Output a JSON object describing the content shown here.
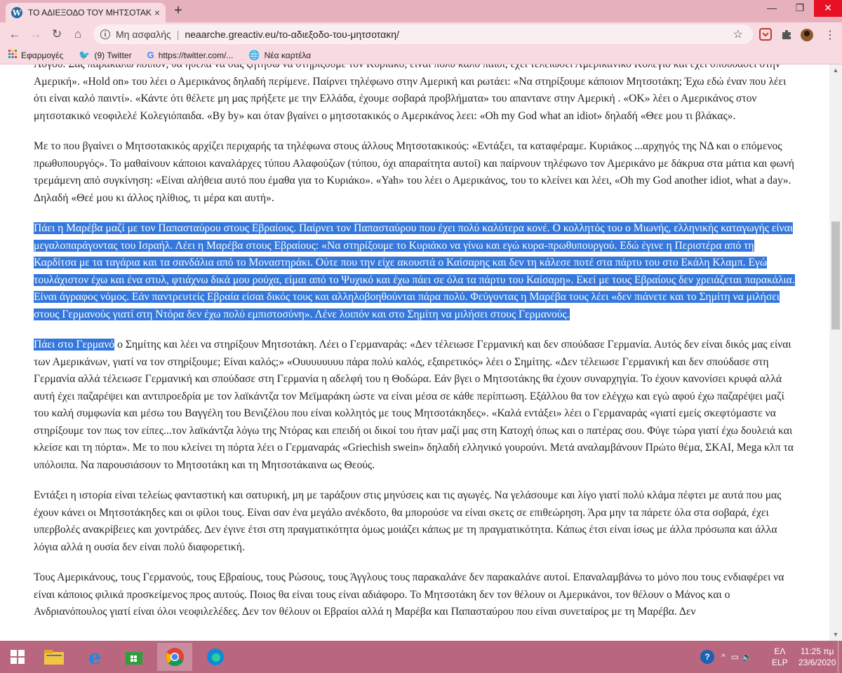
{
  "browser": {
    "tab_title": "ΤΟ ΑΔΙΕΞΟΔΟ ΤΟΥ ΜΗΤΣΟΤΑΚΗ",
    "tab_close": "×",
    "new_tab": "+",
    "security_label": "Μη ασφαλής",
    "url": "neaarche.greactiv.eu/το-αδιεξοδο-του-μητσοτακη/",
    "favicon_letter": "W",
    "bookmarks": [
      {
        "label": "Εφαρμογές",
        "icon": "apps-grid-icon"
      },
      {
        "label": "(9) Twitter",
        "icon": "twitter-icon"
      },
      {
        "label": "https://twitter.com/...",
        "icon": "google-icon"
      },
      {
        "label": "Νέα καρτέλα",
        "icon": "globe-icon"
      }
    ]
  },
  "article": {
    "p1": "Λόγου. Σας παρακαλώ λοιπόν, θα ήθελα να σας ζητήσω να στηρίξουμε τον Κυριάκο, είναι πολύ καλό παιδί, έχει τελειώσει Αμερικάνικο Κολέγιο και έχει σπουδάσει στην Αμερική». «Hold on» του λέει ο Αμερικάνος δηλαδή περίμενε. Παίρνει τηλέφωνο στην Αμερική και ρωτάει: «Να στηρίξουμε κάποιον Μητσοτάκη; Έχω εδώ έναν που λέει ότι είναι καλό παιντί». «Κάντε ότι θέλετε μη μας πρήξετε με την Ελλάδα, έχουμε σοβαρά προβλήματα» του απαντανε στην Αμερική . «OK» λέει ο Αμερικάνος στον μητσοτακικό νεοφιλελέ Κολεγιόπαιδα. «By by» και όταν βγαίνει ο μητσοτακικός ο Αμερικάνος λεει: «Oh my God what an idiot» δηλαδή «Θεε μου τι βλάκας».",
    "p2": "Με το που βγαίνει ο Μητσοτακικός αρχίζει περιχαρής τα τηλέφωνα στους άλλους Μητσοτακικούς: «Εντάξει, τα καταφέραμε. Κυριάκος ...αρχηγός της ΝΔ και ο επόμενος πρωθυπουργός». Το μαθαίνουν κάποιοι καναλάρχες τύπου Αλαφούζων (τύπου, όχι απαραίτητα αυτοί) και παίρνουν τηλέφωνο τον Αμερικάνο με δάκρυα στα μάτια και φωνή τρεμάμενη από συγκίνηση: «Είναι αλήθεια αυτό που έμαθα για το Κυριάκο». «Yah» του λέει ο Αμερικάνος, του το κλείνει και λέει, «Oh my God another idiot, what a day». Δηλαδή «Θεέ μου κι άλλος ηλίθιος, τι μέρα και αυτή».",
    "p3": "Πάει η Μαρέβα μαζί με τον Παπασταύρου στους Εβραίους. Παίρνει τον Παπασταύρου που έχει πολύ καλύτερα κονέ. Ο κολλητός του ο Μιωνής, ελληνικής καταγωγής είναι μεγαλοπαράγοντας του Ισραήλ.  Λέει η Μαρέβα στους Εβραίους: «Να στηρίξουμε το Κυριάκο να γίνω και εγώ κυρα-πρωθυπουργού. Εδώ έγινε η Περιστέρα από τη Καρδίτσα με τα ταγάρια και τα σανδάλια από το Μοναστηράκι. Ούτε που την είχε ακουστά ο Καίσαρης και δεν τη κάλεσε ποτέ στα πάρτυ του στο Εκάλη Κλαμπ. Εγώ τουλάχιστον έχω και ένα στυλ, φτιάχνω δικά μου ρούχα, είμαι από το Ψυχικό και έχω πάει σε όλα τα πάρτυ του Καίσαρη». Εκεί με τους Εβραίους δεν χρειάζεται παρακάλια. Είναι άγραφος νόμος. Εάν παντρευτείς Εβραία είσαι δικός τους και αλληλοβοηθούνται πάρα πολύ. Φεύγοντας η Μαρέβα τους λέει «δεν πιάνετε και το Σημίτη να μιλήσει στους Γερμανούς γιατί στη Ντόρα δεν έχω πολύ εμπιστοσύνη». Λένε λοιπόν και στο Σημίτη να μιλήσει στους Γερμανούς.",
    "p4_highlight": "Πάει στο Γερμανό",
    "p4_rest": " ο Σημίτης και λέει να στηρίξουν Μητσοτάκη. Λέει ο Γερμαναράς: «Δεν τέλειωσε Γερμανική και δεν σπούδασε Γερμανία. Αυτός δεν είναι δικός μας είναι των Αμερικάνων, γιατί να τον στηρίξουμε; Είναι καλός;»  «Ουυυυυυυυ πάρα πολύ καλός, εξαιρετικός» λέει ο Σημίτης. «Δεν τέλειωσε Γερμανική και δεν σπούδασε στη Γερμανία αλλά τέλειωσε Γερμανική και σπούδασε στη Γερμανία η αδελφή του η Θοδώρα. Εάν βγει ο Μητσοτάκης θα έχουν συναρχηγία. Το έχουν κανονίσει κρυφά αλλά αυτή έχει παζαρέψει και αντιπροεδρία με τον λαϊκάντζα  τον Μεϊμαράκη ώστε να είναι μέσα σε κάθε περίπτωση. Εξάλλου θα τον ελέγχω και εγώ αφού έχω παζαρέψει μαζί του καλή συμφωνία και μέσω του Βαγγέλη του Βενιζέλου που είναι κολλητός με τους Μητσοτάκηδες». «Καλά εντάξει» λέει ο Γερμαναράς «γιατί εμείς σκεφτόμαστε να στηρίξουμε τον πως τον είπες...τον λαϊκάντζα λόγω της Ντόρας και επειδή οι δικοί του ήταν μαζί μας στη Κατοχή όπως και ο πατέρας σου. Φύγε τώρα γιατί έχω δουλειά και κλείσε και τη πόρτα». Με το που κλείνει τη πόρτα λέει ο Γερμαναράς «Griechish swein» δηλαδή ελληνικό γουρούνι. Μετά αναλαμβάνουν Πρώτο θέμα, ΣΚΑΙ, Mega κλπ τα υπόλοιπα. Να παρουσιάσουν το Μητσοτάκη και τη Μητσοτάκαινα ως Θεούς.",
    "p5": "Εντάξει η ιστορία είναι τελείως φανταστική και σατυρική, μη με τaράξουν στις μηνύσεις και τις αγωγές. Να γελάσουμε και λίγο γιατί πολύ κλάμα πέφτει με αυτά που μας έχουν κάνει οι Μητσοτάκηδες και οι φίλοι τους. Είναι σαν ένα μεγάλο ανέκδοτο, θα μπορούσε να είναι σκετς σε επιθεώρηση. Άρα μην τα πάρετε όλα στα σοβαρά, έχει υπερβολές ανακρίβειες και χοντράδες. Δεν έγινε έτσι στη πραγματικότητα όμως μοιάζει κάπως με τη πραγματικότητα. Κάπως έτσι είναι ίσως με άλλα πρόσωπα και άλλα λόγια αλλά η ουσία δεν είναι πολύ διαφορετική.",
    "p6": "Τους Αμερικάνους, τους Γερμανούς, τους Εβραίους, τους Ρώσους, τους Άγγλους τους παρακαλάνε δεν παρακαλάνε αυτοί. Επαναλαμβάνω το μόνο που τους ενδιαφέρει να είναι κάποιος φιλικά προσκείμενος προς αυτούς. Ποιος θα είναι τους είναι αδιάφορο. Το Μητσοτάκη δεν τον θέλουν οι Αμερικάνοι, τον θέλουν ο Μάνος και ο Ανδριανόπουλος γιατί είναι όλοι νεοφιλελέδες. Δεν τον θέλουν οι Εβραίοι αλλά η Μαρέβα και Παπασταύρου που είναι συνεταίρος με τη Μαρέβα. Δεν"
  },
  "taskbar": {
    "lang_top": "ΕΛ",
    "lang_bottom": "ELP",
    "time": "11:25 πμ",
    "date": "23/6/2020"
  },
  "colors": {
    "chrome_frame": "#e6b1bc",
    "chrome_toolbar": "#f7dbe1",
    "selection": "#3478dc",
    "taskbar": "#b8677f"
  }
}
